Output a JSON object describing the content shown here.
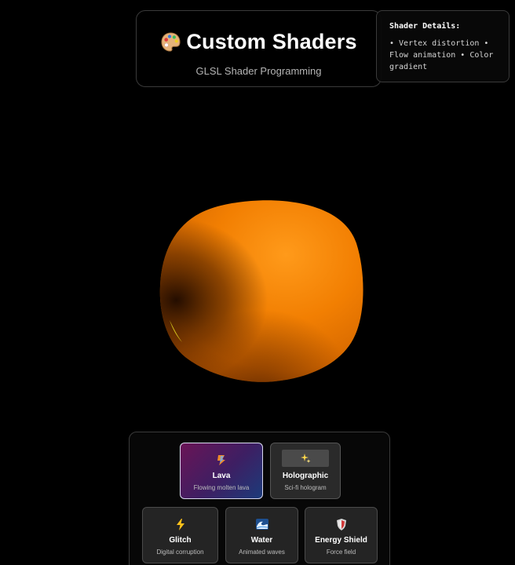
{
  "header": {
    "icon": "palette-icon",
    "title": "Custom Shaders",
    "subtitle": "GLSL Shader Programming"
  },
  "details": {
    "title": "Shader Details:",
    "body": "• Vertex distortion • Flow animation • Color gradient"
  },
  "scene": {
    "object": "distorted-sphere",
    "colors": {
      "highlight": "#ff9a1a",
      "mid": "#f07a00",
      "shadow": "#3a1600",
      "rim": "#e8e020"
    }
  },
  "shaders": [
    {
      "id": "lava",
      "name": "Lava",
      "desc": "Flowing molten lava",
      "icon": "lava-icon",
      "active": true
    },
    {
      "id": "holographic",
      "name": "Holographic",
      "desc": "Sci-fi hologram",
      "icon": "sparkles-icon",
      "active": false
    },
    {
      "id": "glitch",
      "name": "Glitch",
      "desc": "Digital corruption",
      "icon": "lightning-icon",
      "active": false
    },
    {
      "id": "water",
      "name": "Water",
      "desc": "Animated waves",
      "icon": "wave-icon",
      "active": false
    },
    {
      "id": "energy",
      "name": "Energy Shield",
      "desc": "Force field",
      "icon": "shield-icon",
      "active": false
    }
  ],
  "colors": {
    "active_card_start": "#6a1456",
    "active_card_end": "#1c3b7a",
    "card_bg": "#242424",
    "border": "#3a3a3a"
  }
}
